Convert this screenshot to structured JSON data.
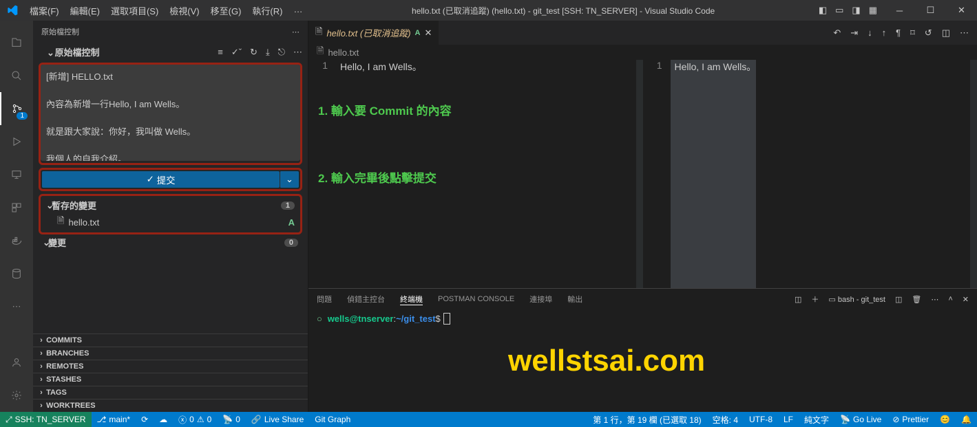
{
  "title": "hello.txt (已取消追蹤) (hello.txt) - git_test [SSH: TN_SERVER] - Visual Studio Code",
  "menu": [
    "檔案(F)",
    "編輯(E)",
    "選取項目(S)",
    "檢視(V)",
    "移至(G)",
    "執行(R)",
    "…"
  ],
  "scm": {
    "panel_title": "原始檔控制",
    "provider_title": "原始檔控制",
    "commit_message": "[新增] HELLO.txt\n\n內容為新增一行Hello, I am Wells。\n\n就是跟大家說：你好，我叫做 Wells。\n\n我個人的自我介紹。",
    "commit_btn": "提交",
    "staged_label": "暫存的變更",
    "staged_count": "1",
    "staged_file": "hello.txt",
    "staged_status": "A",
    "changes_label": "變更",
    "changes_count": "0",
    "sections": [
      "COMMITS",
      "BRANCHES",
      "REMOTES",
      "STASHES",
      "TAGS",
      "WORKTREES"
    ]
  },
  "tab": {
    "name": "hello.txt (已取消追蹤)",
    "mod": "A"
  },
  "breadcrumb": "hello.txt",
  "editor": {
    "line_no": "1",
    "content": "Hello, I am Wells。"
  },
  "annotations": {
    "a1": "1. 輸入要 Commit 的內容",
    "a2": "2. 輸入完畢後點擊提交"
  },
  "watermark": "wellstsai.com",
  "panel": {
    "tabs": [
      "問題",
      "偵錯主控台",
      "終端機",
      "POSTMAN CONSOLE",
      "連接埠",
      "輸出"
    ],
    "active": 2,
    "term_label": "bash - git_test",
    "prompt_user": "wells@tnserver",
    "prompt_path": "~/git_test",
    "prompt_symbol": "$"
  },
  "status": {
    "remote": "SSH: TN_SERVER",
    "branch": "main*",
    "sync": "⟳",
    "errors": "0",
    "warnings": "0",
    "ports": "0",
    "live_share": "Live Share",
    "git_graph": "Git Graph",
    "cursor": "第 1 行，第 19 欄 (已選取 18)",
    "indent": "空格: 4",
    "encoding": "UTF-8",
    "eol": "LF",
    "lang": "純文字",
    "go_live": "Go Live",
    "prettier": "Prettier"
  },
  "activity_badge": "1"
}
